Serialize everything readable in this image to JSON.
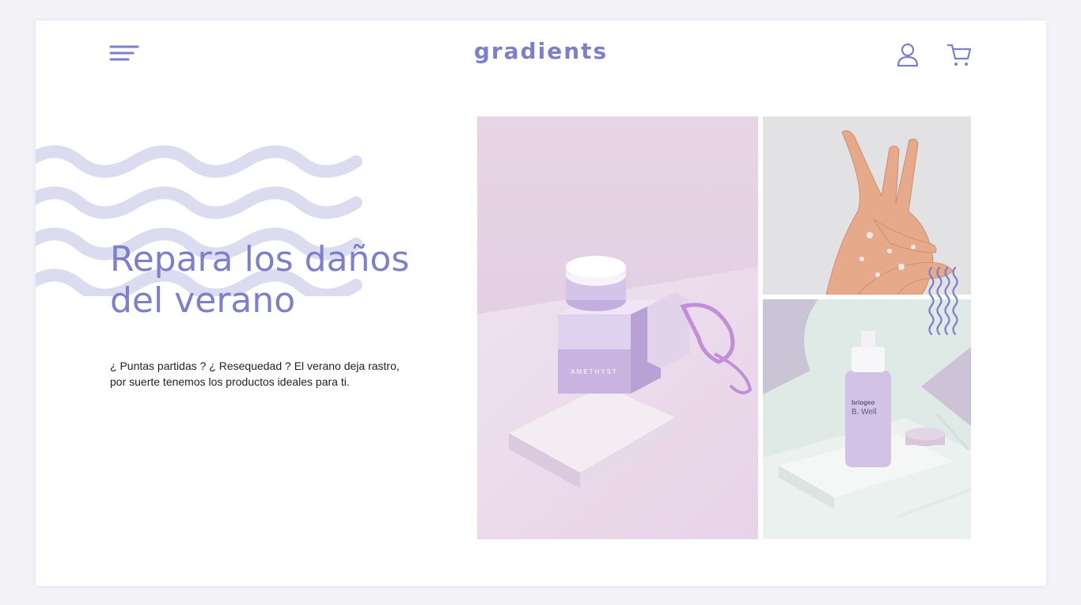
{
  "brand": {
    "logo_text": "gradients",
    "accent_color": "#7b7fcc",
    "wave_color": "#dcdcf0"
  },
  "header": {
    "menu_icon": "hamburger-menu-icon",
    "user_icon": "user-icon",
    "cart_icon": "shopping-cart-icon"
  },
  "hero": {
    "headline_line1": "Repara los daños",
    "headline_line2": "del verano",
    "intro_line1": "¿ Puntas partidas ? ¿ Resequedad ? El verano deja rastro,",
    "intro_line2": "por suerte tenemos los productos ideales para ti."
  },
  "gallery": {
    "main_jar_label": "AMETHYST",
    "bottle_brand": "briogeo",
    "bottle_name": "B. Well"
  }
}
